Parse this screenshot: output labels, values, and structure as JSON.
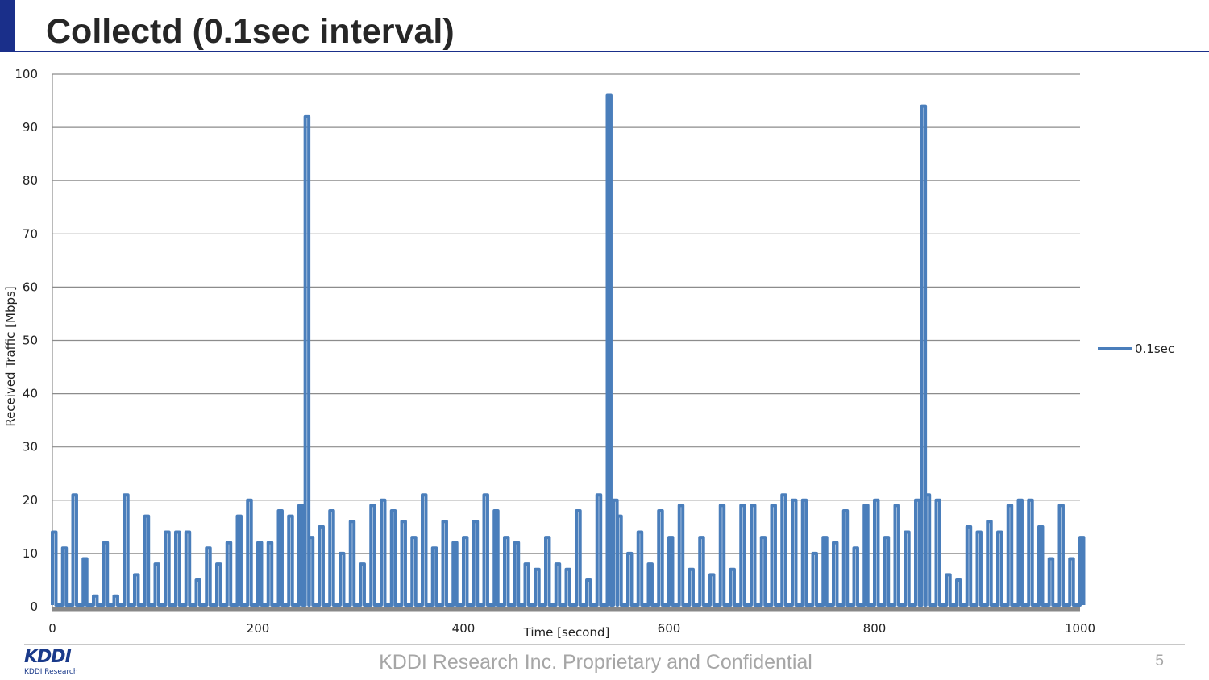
{
  "slide": {
    "title": "Collectd (0.1sec interval)",
    "footer": "KDDI Research Inc. Proprietary and Confidential",
    "page_number": "5",
    "logo": {
      "mark": "KDDI",
      "sub": "KDDI Research"
    }
  },
  "colors": {
    "accent": "#1a2f8a",
    "series": "#4a7ebb",
    "grid": "#8c8c8c"
  },
  "chart_data": {
    "type": "line",
    "title": "",
    "xlabel": "Time [second]",
    "ylabel": "Received Traffic [Mbps]",
    "xlim": [
      0,
      1000
    ],
    "ylim": [
      0,
      100
    ],
    "xticks": [
      0,
      200,
      400,
      600,
      800,
      1000
    ],
    "yticks": [
      0,
      10,
      20,
      30,
      40,
      50,
      60,
      70,
      80,
      90,
      100
    ],
    "grid": true,
    "legend_position": "right",
    "series": [
      {
        "name": "0.1sec",
        "color": "#4a7ebb",
        "x": [
          0,
          10,
          20,
          30,
          40,
          50,
          60,
          70,
          80,
          90,
          100,
          110,
          120,
          130,
          140,
          150,
          160,
          170,
          180,
          190,
          200,
          210,
          220,
          230,
          240,
          246,
          250,
          260,
          270,
          280,
          290,
          300,
          310,
          320,
          330,
          340,
          350,
          360,
          370,
          380,
          390,
          400,
          410,
          420,
          430,
          440,
          450,
          460,
          470,
          480,
          490,
          500,
          510,
          520,
          530,
          540,
          546,
          550,
          560,
          570,
          580,
          590,
          600,
          610,
          620,
          630,
          640,
          650,
          660,
          670,
          680,
          690,
          700,
          710,
          720,
          730,
          740,
          750,
          760,
          770,
          780,
          790,
          800,
          810,
          820,
          830,
          840,
          846,
          850,
          860,
          870,
          880,
          890,
          900,
          910,
          920,
          930,
          940,
          950,
          960,
          970,
          980,
          990,
          1000
        ],
        "y": [
          14,
          11,
          21,
          9,
          2,
          12,
          2,
          21,
          6,
          17,
          8,
          14,
          14,
          14,
          5,
          11,
          8,
          12,
          17,
          20,
          12,
          12,
          18,
          17,
          19,
          92,
          13,
          15,
          18,
          10,
          16,
          8,
          19,
          20,
          18,
          16,
          13,
          21,
          11,
          16,
          12,
          13,
          16,
          21,
          18,
          13,
          12,
          8,
          7,
          13,
          8,
          7,
          18,
          5,
          21,
          96,
          20,
          17,
          10,
          14,
          8,
          18,
          13,
          19,
          7,
          13,
          6,
          19,
          7,
          19,
          19,
          13,
          19,
          21,
          20,
          20,
          10,
          13,
          12,
          18,
          11,
          19,
          20,
          13,
          19,
          14,
          20,
          94,
          21,
          20,
          6,
          5,
          15,
          14,
          16,
          14,
          19,
          20,
          20,
          15,
          9,
          19,
          9,
          13
        ]
      }
    ]
  }
}
